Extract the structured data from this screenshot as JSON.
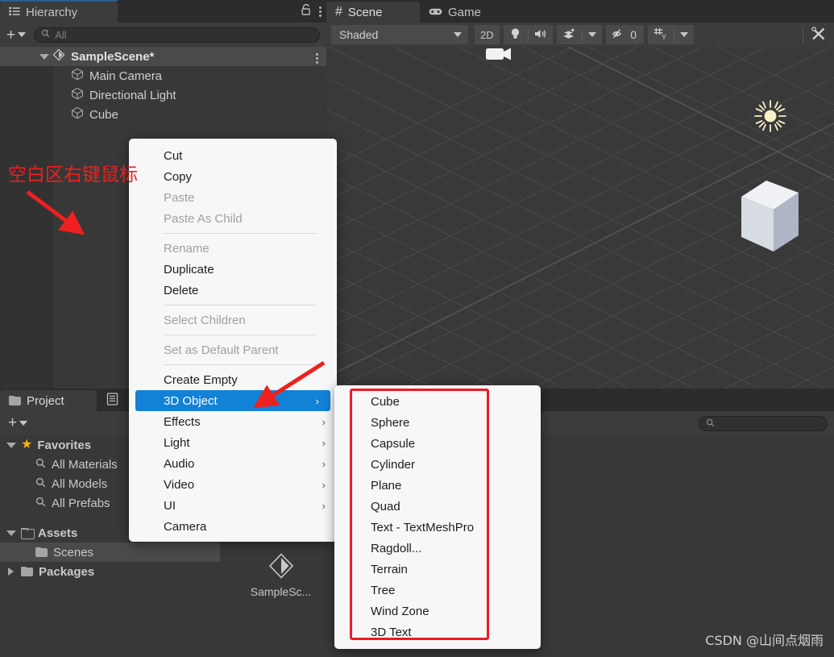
{
  "hierarchy": {
    "tab_label": "Hierarchy",
    "tab_icon": "hierarchy-list-icon",
    "lock_icon": "lock-icon",
    "menu_icon": "kebab-menu-icon",
    "add_button_label": "+",
    "search_placeholder": "All",
    "scene": {
      "name": "SampleScene*",
      "expanded": true
    },
    "objects": [
      {
        "name": "Main Camera"
      },
      {
        "name": "Directional Light"
      },
      {
        "name": "Cube"
      }
    ]
  },
  "scene_panel": {
    "tabs": [
      {
        "label": "Scene",
        "icon": "hash-icon",
        "active": true
      },
      {
        "label": "Game",
        "icon": "gamepad-icon",
        "active": false
      }
    ],
    "toolbar": {
      "draw_mode": "Shaded",
      "mode_2d": "2D",
      "lighting_icon": "lightbulb-icon",
      "audio_icon": "speaker-icon",
      "fx_icon": "effects-icon",
      "fx_dropdown_icon": "chevron-down-icon",
      "hidden_objects_icon": "eye-off-icon",
      "hidden_objects_count": "0",
      "grid_icon": "grid-icon",
      "grid_dropdown_icon": "chevron-down-icon",
      "tools_icon": "tools-icon"
    },
    "gizmos": [
      {
        "name": "camera-gizmo",
        "label": "Main Camera"
      },
      {
        "name": "light-gizmo",
        "label": "Directional Light"
      },
      {
        "name": "cube-object",
        "label": "Cube"
      }
    ]
  },
  "project_panel": {
    "tab_label": "Project",
    "tab_icon": "folder-icon",
    "console_tab_icon": "console-icon",
    "add_button_label": "+",
    "search_placeholder": "",
    "tree": [
      {
        "label": "Favorites",
        "icon": "star-icon",
        "indent": 0,
        "expanded": true,
        "selected": false
      },
      {
        "label": "All Materials",
        "icon": "search-icon",
        "indent": 1,
        "selected": false
      },
      {
        "label": "All Models",
        "icon": "search-icon",
        "indent": 1,
        "selected": false
      },
      {
        "label": "All Prefabs",
        "icon": "search-icon",
        "indent": 1,
        "selected": false
      },
      {
        "label": "Assets",
        "icon": "folder-open-icon",
        "indent": 0,
        "expanded": true,
        "selected": false
      },
      {
        "label": "Scenes",
        "icon": "folder-icon",
        "indent": 1,
        "selected": true
      },
      {
        "label": "Packages",
        "icon": "folder-icon",
        "indent": 0,
        "expanded": false,
        "selected": false
      }
    ],
    "assets": [
      {
        "label": "SampleSc...",
        "icon": "unity-scene-icon"
      }
    ]
  },
  "context_menu": {
    "items": [
      {
        "label": "Cut",
        "disabled": false,
        "submenu": false
      },
      {
        "label": "Copy",
        "disabled": false,
        "submenu": false
      },
      {
        "label": "Paste",
        "disabled": true,
        "submenu": false
      },
      {
        "label": "Paste As Child",
        "disabled": true,
        "submenu": false
      },
      {
        "separator": true
      },
      {
        "label": "Rename",
        "disabled": true,
        "submenu": false
      },
      {
        "label": "Duplicate",
        "disabled": false,
        "submenu": false
      },
      {
        "label": "Delete",
        "disabled": false,
        "submenu": false
      },
      {
        "separator": true
      },
      {
        "label": "Select Children",
        "disabled": true,
        "submenu": false
      },
      {
        "separator": true
      },
      {
        "label": "Set as Default Parent",
        "disabled": true,
        "submenu": false
      },
      {
        "separator": true
      },
      {
        "label": "Create Empty",
        "disabled": false,
        "submenu": false
      },
      {
        "label": "3D Object",
        "disabled": false,
        "submenu": true,
        "highlighted": true
      },
      {
        "label": "Effects",
        "disabled": false,
        "submenu": true
      },
      {
        "label": "Light",
        "disabled": false,
        "submenu": true
      },
      {
        "label": "Audio",
        "disabled": false,
        "submenu": true
      },
      {
        "label": "Video",
        "disabled": false,
        "submenu": true
      },
      {
        "label": "UI",
        "disabled": false,
        "submenu": true
      },
      {
        "label": "Camera",
        "disabled": false,
        "submenu": false
      }
    ],
    "submenu_arrow": "›"
  },
  "submenu_3d_object": {
    "items": [
      {
        "label": "Cube"
      },
      {
        "label": "Sphere"
      },
      {
        "label": "Capsule"
      },
      {
        "label": "Cylinder"
      },
      {
        "label": "Plane"
      },
      {
        "label": "Quad"
      },
      {
        "label": "Text - TextMeshPro"
      },
      {
        "label": "Ragdoll..."
      },
      {
        "label": "Terrain"
      },
      {
        "label": "Tree"
      },
      {
        "label": "Wind Zone"
      },
      {
        "label": "3D Text"
      }
    ]
  },
  "annotations": {
    "note_text": "空白区右键鼠标",
    "note_color": "#ee2020",
    "arrow_color": "#ee2020",
    "watermark": "CSDN @山间点烟雨"
  },
  "colors": {
    "accent_blue": "#1282d6",
    "annotation_red": "#ee2020",
    "panel_bg": "#383838",
    "toolbar_bg": "#3c3c3c",
    "tab_bg": "#2c2c2c",
    "menu_bg": "#f7f7f7",
    "selection_gray": "#4a4a4a"
  }
}
